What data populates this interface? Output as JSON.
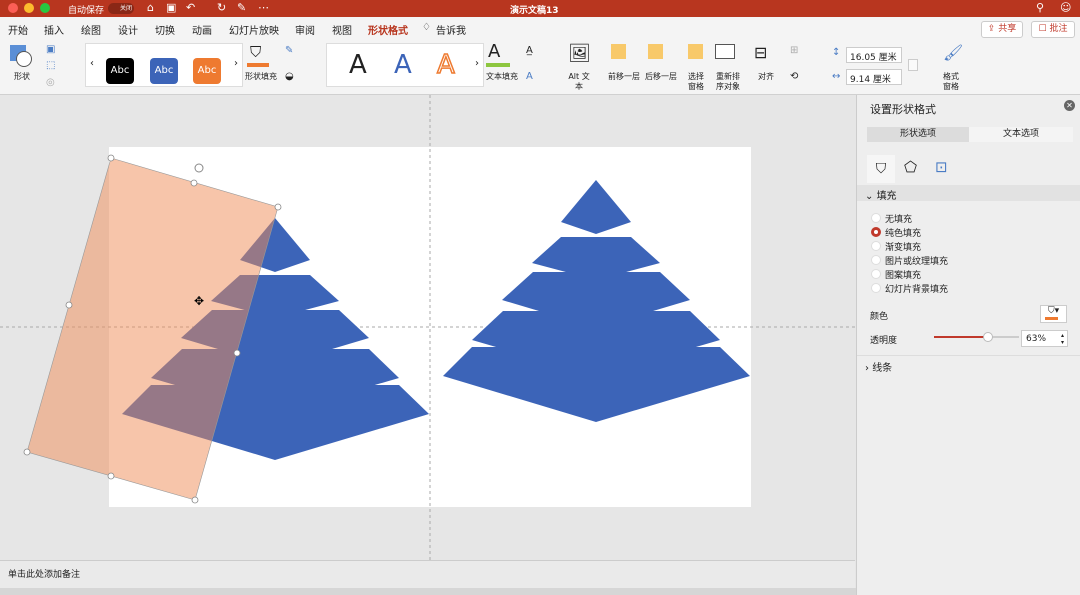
{
  "titlebar": {
    "autosave": "自动保存",
    "toggle": "关闭",
    "title": "演示文稿13"
  },
  "tabs": [
    "开始",
    "插入",
    "绘图",
    "设计",
    "切换",
    "动画",
    "幻灯片放映",
    "审阅",
    "视图",
    "形状格式",
    "告诉我"
  ],
  "active_tab": "形状格式",
  "share": "共享",
  "comments": "批注",
  "ribbon": {
    "shape": "形状",
    "styles": [
      "Abc",
      "Abc",
      "Abc"
    ],
    "shape_fill": "形状填充",
    "text_fill": "文本填充",
    "alt_text": "Alt 文本",
    "bring_forward": "前移一层",
    "send_backward": "后移一层",
    "selection_pane": "选择窗格",
    "reorder": "重新排序对象",
    "align": "对齐",
    "height": "16.05 厘米",
    "width": "9.14 厘米",
    "format_pane": "格式窗格"
  },
  "panel": {
    "title": "设置形状格式",
    "tab_shape": "形状选项",
    "tab_text": "文本选项",
    "fill_section": "填充",
    "fill_options": [
      "无填充",
      "纯色填充",
      "渐变填充",
      "图片或纹理填充",
      "图案填充",
      "幻灯片背景填充"
    ],
    "selected_fill": "纯色填充",
    "color_label": "颜色",
    "transparency_label": "透明度",
    "transparency": "63%",
    "transparency_value": 63,
    "line_section": "线条"
  },
  "notes": "单击此处添加备注",
  "colors": {
    "accent": "#b8361f",
    "pyramid": "#3c64b8",
    "shape_fill": "#ef8c55"
  }
}
